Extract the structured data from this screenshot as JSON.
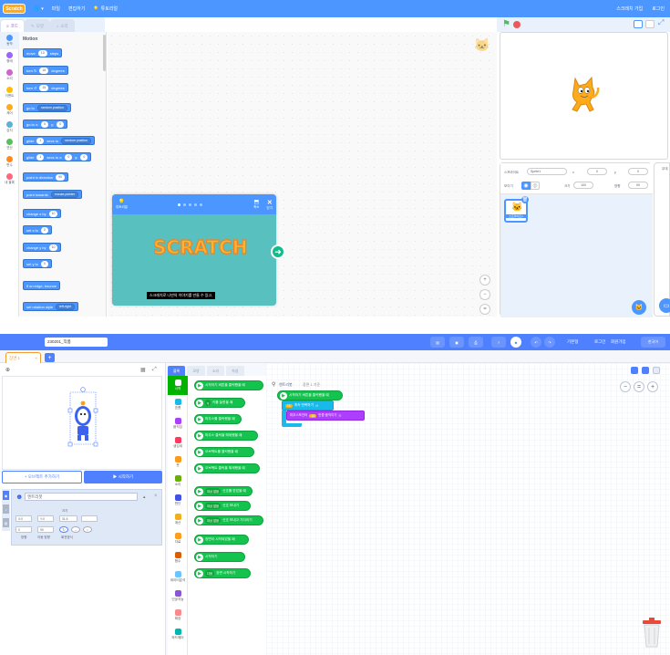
{
  "scratch": {
    "menu": {
      "logo": "Scratch",
      "language": "",
      "file": "파일",
      "edit": "편집하기",
      "tutorials": "튜토리얼",
      "join": "스크래치 가입",
      "signin": "로그인"
    },
    "tabs": [
      "코드",
      "모양",
      "소리"
    ],
    "categories": [
      {
        "label": "동작",
        "color": "#4c97ff"
      },
      {
        "label": "형태",
        "color": "#9966ff"
      },
      {
        "label": "소리",
        "color": "#cf63cf"
      },
      {
        "label": "이벤트",
        "color": "#ffbf00"
      },
      {
        "label": "제어",
        "color": "#ffab19"
      },
      {
        "label": "감지",
        "color": "#5cb1d6"
      },
      {
        "label": "연산",
        "color": "#59c059"
      },
      {
        "label": "변수",
        "color": "#ff8c1a"
      },
      {
        "label": "내 블록",
        "color": "#ff6680"
      }
    ],
    "palette_title": "Motion",
    "blocks": [
      {
        "pre": "move",
        "v1": "10",
        "post": "steps"
      },
      {
        "pre": "turn ↻",
        "v1": "15",
        "post": "degrees"
      },
      {
        "pre": "turn ↺",
        "v1": "15",
        "post": "degrees"
      },
      {
        "pre": "go to",
        "dd": "random position"
      },
      {
        "pre": "go to x:",
        "v1": "0",
        "mid": "y:",
        "v2": "0"
      },
      {
        "pre": "glide",
        "v1": "1",
        "mid": "secs to",
        "dd": "random position"
      },
      {
        "pre": "glide",
        "v1": "1",
        "mid": "secs to x:",
        "v2": "0",
        "post2": "y:",
        "v3": "0"
      },
      {
        "pre": "point in direction",
        "v1": "90"
      },
      {
        "pre": "point towards",
        "dd": "mouse-pointer"
      },
      {
        "pre": "change x by",
        "v1": "10"
      },
      {
        "pre": "set x to",
        "v1": "0"
      },
      {
        "pre": "change y by",
        "v1": "10"
      },
      {
        "pre": "set y to",
        "v1": "0"
      },
      {
        "pre": "if on edge, bounce"
      },
      {
        "pre": "set rotation style",
        "dd": "left-right"
      }
    ],
    "tutorial": {
      "title": "튜토리얼",
      "shrink": "축소",
      "close": "닫기",
      "caption": "스크래치로 나만의 이야기를 만들 수 있고,",
      "logo_text": "SCRATCH"
    },
    "sprite_info": {
      "sprite_label": "스프라이트",
      "sprite_name": "Sprite1",
      "x_label": "x",
      "x_value": "0",
      "y_label": "y",
      "y_value": "0",
      "show_label": "보이기",
      "size_label": "크기",
      "size_value": "100",
      "direction_label": "방향",
      "direction_value": "90"
    },
    "sprite_card": "스프라이트1",
    "backdrop_label": "무대"
  },
  "entry": {
    "project_name": "230201_작품",
    "header": {
      "lang": "한국어",
      "login": "로그인",
      "signup": "회원가입",
      "save": "저장하기",
      "user": "기본형"
    },
    "scene_tab": "장면 1",
    "speed_label": "속도",
    "add_object": "+ 오브젝트 추가하기",
    "start": "▶ 시작하기",
    "object_name": "엔트리봇",
    "object_fields": {
      "x_label": "X",
      "x_value": "0",
      "y_label": "Y",
      "y_value": "0",
      "size_label": "크기",
      "size_value": "31.6",
      "dir_label": "방향",
      "dir_value": "0",
      "move_label": "이동 방향",
      "move_value": "90",
      "rotate_label": "회전방식"
    },
    "mid_tabs": [
      "블록",
      "모양",
      "소리",
      "속성"
    ],
    "categories": [
      {
        "label": "시작",
        "color": "#00b400"
      },
      {
        "label": "흐름",
        "color": "#19baea"
      },
      {
        "label": "움직임",
        "color": "#ad3efb"
      },
      {
        "label": "생김새",
        "color": "#ff3a61"
      },
      {
        "label": "붓",
        "color": "#fc9a1e"
      },
      {
        "label": "소리",
        "color": "#67b100"
      },
      {
        "label": "판단",
        "color": "#4252e7"
      },
      {
        "label": "계산",
        "color": "#f4af18"
      },
      {
        "label": "자료",
        "color": "#ff9e20"
      },
      {
        "label": "함수",
        "color": "#de5c04"
      },
      {
        "label": "데이터분석",
        "color": "#6bc5ff"
      },
      {
        "label": "인공지능",
        "color": "#8a55d7"
      },
      {
        "label": "확장",
        "color": "#ff8888"
      },
      {
        "label": "하드웨어",
        "color": "#00b6b1"
      }
    ],
    "blocks": [
      "시작하기 버튼을 클릭했을 때",
      "키를 눌렀을 때",
      "마우스를 클릭했을 때",
      "마우스 클릭을 해제했을 때",
      "오브젝트를 클릭했을 때",
      "오브젝트 클릭을 해제했을 때",
      "신호를 받았을 때",
      "신호 보내기",
      "신호 보내고 기다리기",
      "장면이 시작되었을 때",
      "시작하기",
      "장면 시작하기"
    ],
    "key_dd": "q",
    "signal_dd": "대상 없음",
    "scene_dd": "장면 1",
    "next_dd": "다음",
    "script": {
      "object": "엔트리봇",
      "scene": "장면 1 기준",
      "start": "시작하기 버튼을 클릭했을 때",
      "loop": "계속 반복하기",
      "inner1": "마우스포인터",
      "inner2": "쪽 바라보기",
      "move_val": "10",
      "move_text": "만큼 움직이기"
    }
  }
}
